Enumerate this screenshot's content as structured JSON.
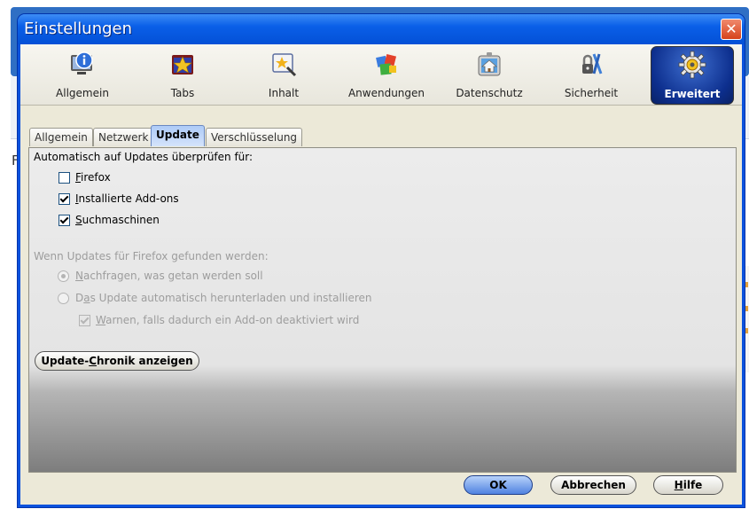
{
  "window": {
    "title": "Einstellungen",
    "close_label": "✕"
  },
  "background": {
    "letter": "F"
  },
  "toolbar": {
    "items": [
      {
        "label": "Allgemein",
        "icon": "general-icon"
      },
      {
        "label": "Tabs",
        "icon": "tabs-icon"
      },
      {
        "label": "Inhalt",
        "icon": "content-icon"
      },
      {
        "label": "Anwendungen",
        "icon": "applications-icon"
      },
      {
        "label": "Datenschutz",
        "icon": "privacy-icon"
      },
      {
        "label": "Sicherheit",
        "icon": "security-icon"
      },
      {
        "label": "Erweitert",
        "icon": "advanced-gear-icon",
        "selected": true
      }
    ]
  },
  "tabs": [
    {
      "label": "Allgemein"
    },
    {
      "label": "Netzwerk"
    },
    {
      "label": "Update",
      "active": true
    },
    {
      "label": "Verschlüsselung"
    }
  ],
  "update": {
    "auto_check_heading": "Automatisch auf Updates überprüfen für:",
    "check_firefox": {
      "key": "F",
      "rest": "irefox",
      "checked": false
    },
    "check_addons": {
      "key": "I",
      "rest": "nstallierte Add-ons",
      "checked": true
    },
    "check_search": {
      "key": "S",
      "rest": "uchmaschinen",
      "checked": true
    },
    "when_found_heading": "Wenn Updates für Firefox gefunden werden:",
    "radio_ask": {
      "key": "N",
      "rest": "achfragen, was getan werden soll",
      "checked": true
    },
    "radio_auto": {
      "pre": "D",
      "key": "a",
      "rest": "s Update automatisch herunterladen und installieren",
      "checked": false
    },
    "check_warn": {
      "key": "W",
      "rest": "arnen, falls dadurch ein Add-on deaktiviert wird",
      "checked": true
    },
    "history_button": {
      "pre": "Update-",
      "key": "C",
      "rest": "hronik anzeigen"
    }
  },
  "buttons": {
    "ok": "OK",
    "cancel": "Abbrechen",
    "help_key": "H",
    "help_rest": "ilfe"
  },
  "colors": {
    "titlebar": "#0a5fe8",
    "dialog_bg": "#ece9d8",
    "selected_toolbar": "#0d2f8e"
  }
}
